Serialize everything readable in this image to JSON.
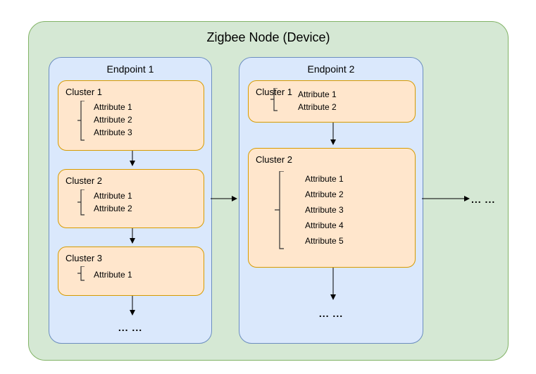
{
  "node": {
    "title": "Zigbee Node (Device)"
  },
  "endpoints": [
    {
      "title": "Endpoint 1",
      "clusters": [
        {
          "title": "Cluster 1",
          "attributes": [
            "Attribute 1",
            "Attribute 2",
            "Attribute 3"
          ]
        },
        {
          "title": "Cluster 2",
          "attributes": [
            "Attribute 1",
            "Attribute 2"
          ]
        },
        {
          "title": "Cluster 3",
          "attributes": [
            "Attribute 1"
          ]
        }
      ],
      "ellipsis": "...  ..."
    },
    {
      "title": "Endpoint 2",
      "clusters": [
        {
          "title": "Cluster 1",
          "attributes": [
            "Attribute 1",
            "Attribute 2"
          ]
        },
        {
          "title": "Cluster 2",
          "attributes": [
            "Attribute 1",
            "Attribute 2",
            "Attribute 3",
            "Attribute 4",
            "Attribute 5"
          ]
        }
      ],
      "ellipsis": "...  ..."
    }
  ],
  "outer_ellipsis": "...  ..."
}
